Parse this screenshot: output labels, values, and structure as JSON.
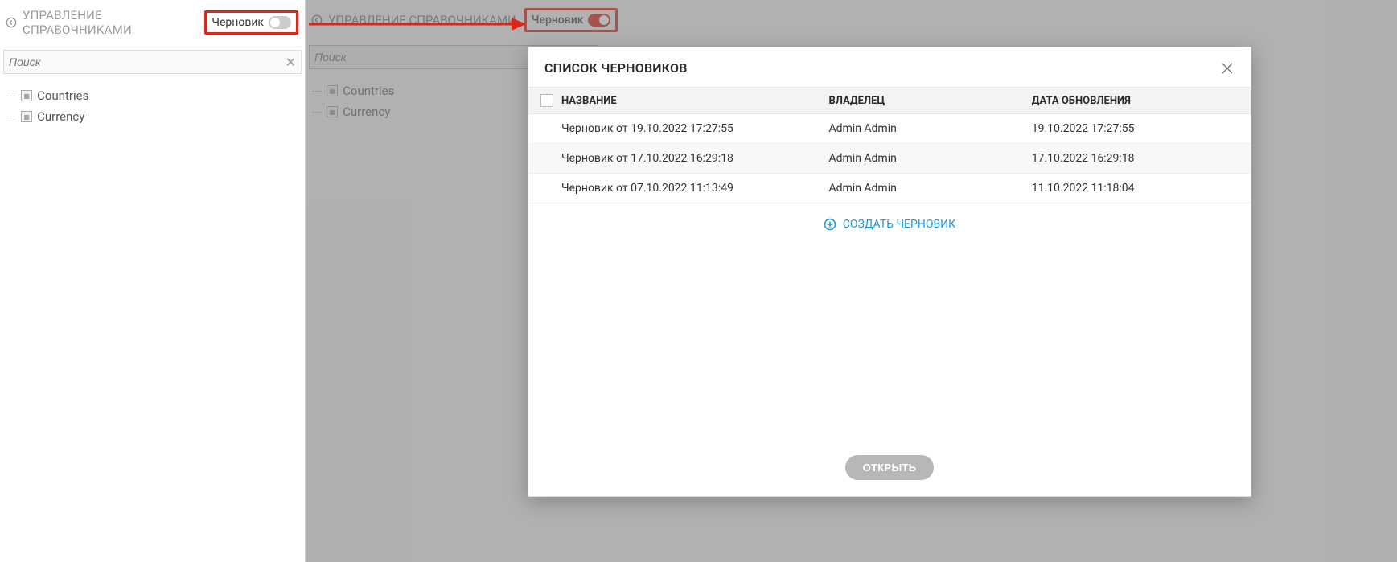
{
  "left": {
    "title": "УПРАВЛЕНИЕ СПРАВОЧНИКАМИ",
    "draft_label": "Черновик",
    "search_placeholder": "Поиск",
    "tree": [
      {
        "label": "Countries"
      },
      {
        "label": "Currency"
      }
    ]
  },
  "right": {
    "title": "УПРАВЛЕНИЕ СПРАВОЧНИКАМИ",
    "draft_label": "Черновик",
    "search_placeholder": "Поиск",
    "tree": [
      {
        "label": "Countries"
      },
      {
        "label": "Currency"
      }
    ]
  },
  "modal": {
    "title": "СПИСОК ЧЕРНОВИКОВ",
    "columns": {
      "name": "НАЗВАНИЕ",
      "owner": "ВЛАДЕЛЕЦ",
      "date": "ДАТА ОБНОВЛЕНИЯ"
    },
    "rows": [
      {
        "name": "Черновик от 19.10.2022 17:27:55",
        "owner": "Admin  Admin",
        "date": "19.10.2022 17:27:55"
      },
      {
        "name": "Черновик от 17.10.2022 16:29:18",
        "owner": "Admin  Admin",
        "date": "17.10.2022 16:29:18"
      },
      {
        "name": "Черновик от 07.10.2022 11:13:49",
        "owner": "Admin  Admin",
        "date": "11.10.2022 11:18:04"
      }
    ],
    "create_label": "СОЗДАТЬ ЧЕРНОВИК",
    "open_button": "ОТКРЫТЬ"
  }
}
